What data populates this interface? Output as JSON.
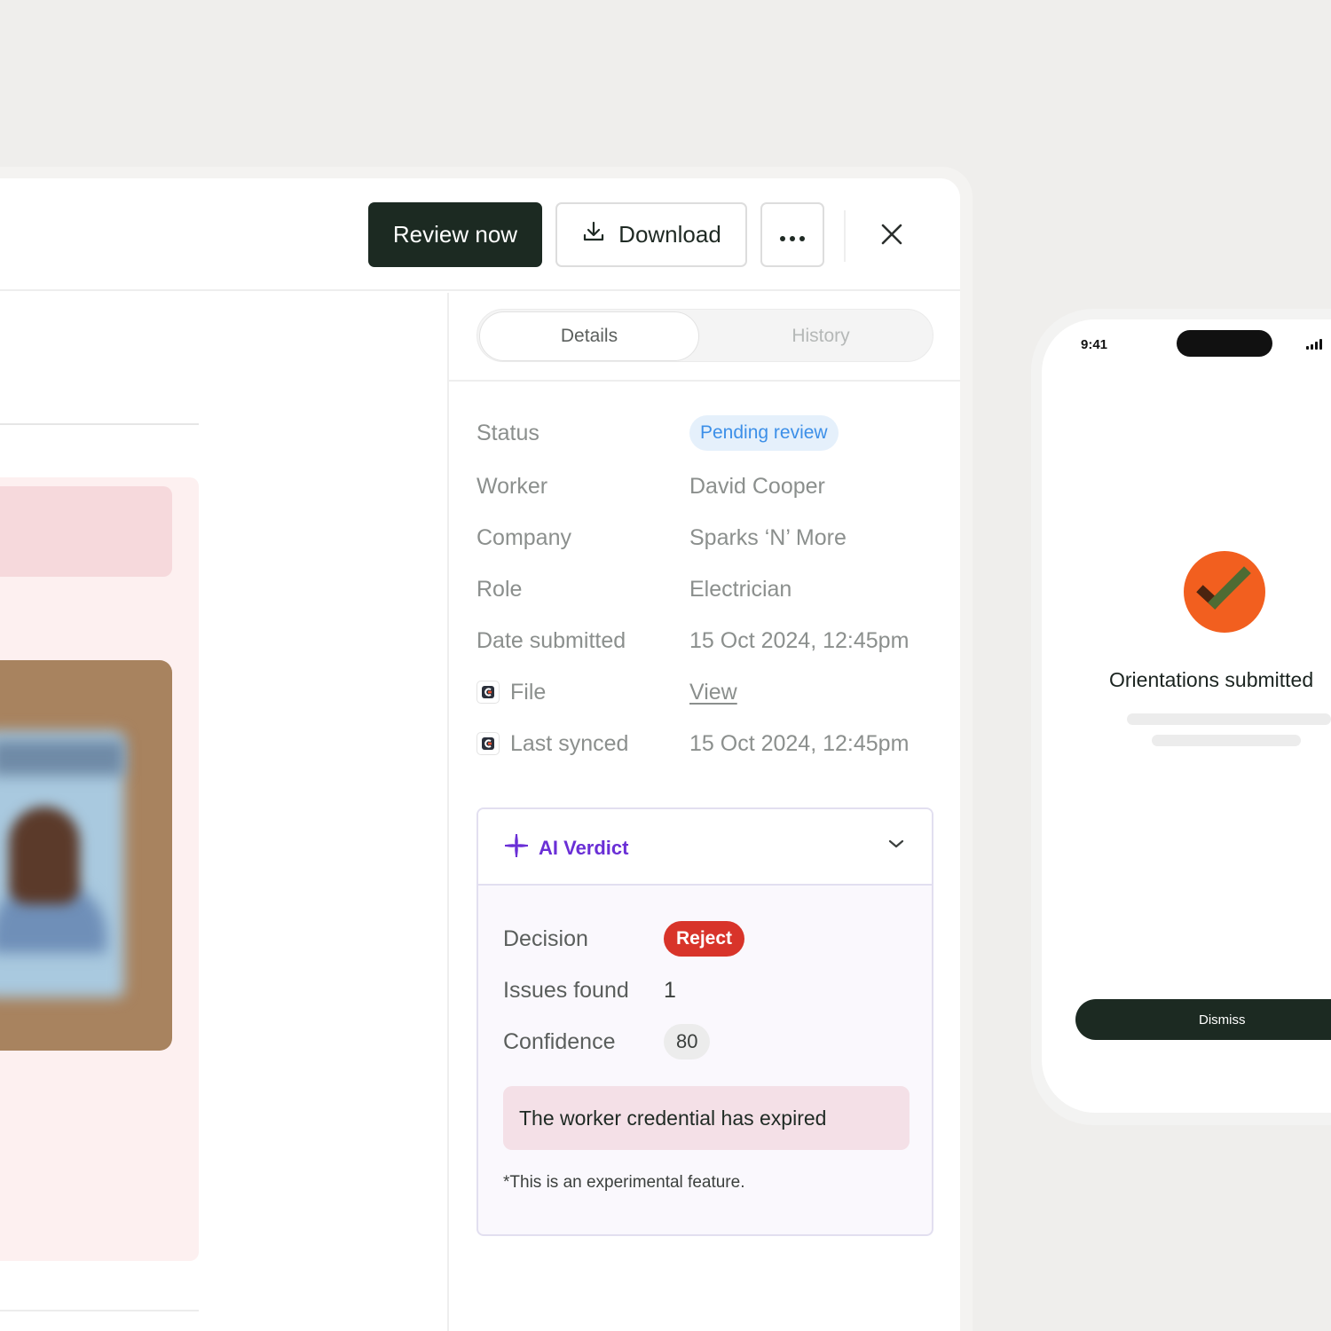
{
  "header": {
    "review_label": "Review now",
    "download_label": "Download",
    "more_icon": "more-horizontal-icon",
    "close_icon": "close-icon"
  },
  "tabs": [
    {
      "label": "Details",
      "active": true
    },
    {
      "label": "History",
      "active": false
    }
  ],
  "details": {
    "status_label": "Status",
    "status_value": "Pending review",
    "worker_label": "Worker",
    "worker_value": "David Cooper",
    "company_label": "Company",
    "company_value": "Sparks ‘N’ More",
    "role_label": "Role",
    "role_value": "Electrician",
    "date_label": "Date submitted",
    "date_value": "15 Oct 2024, 12:45pm",
    "file_label": "File",
    "file_value": "View",
    "synced_label": "Last synced",
    "synced_value": "15 Oct 2024, 12:45pm"
  },
  "verdict": {
    "title": "AI Verdict",
    "decision_label": "Decision",
    "decision_value": "Reject",
    "issues_label": "Issues found",
    "issues_value": "1",
    "confidence_label": "Confidence",
    "confidence_value": "80",
    "issue_text": "The worker credential has expired",
    "note": "*This is an experimental feature."
  },
  "phone": {
    "time": "9:41",
    "title": "Orientations submitted",
    "dismiss_label": "Dismiss"
  },
  "colors": {
    "primary_dark": "#1c2a22",
    "pending_bg": "#e5f0fb",
    "pending_text": "#3c8fe8",
    "reject": "#d8342a",
    "ai_purple": "#6a2fd6",
    "success_orange": "#f25f1f"
  }
}
